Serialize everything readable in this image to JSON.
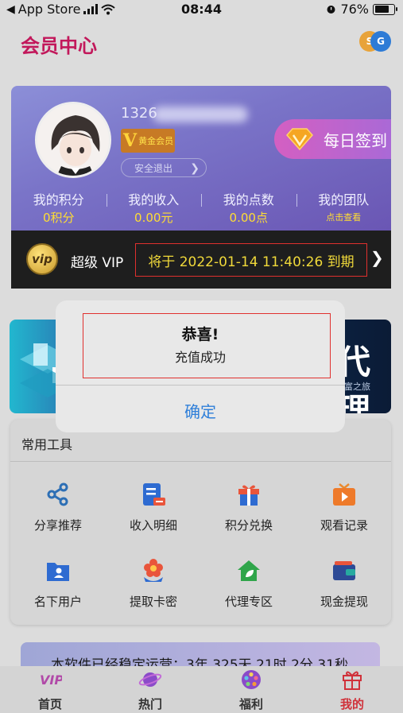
{
  "status_bar": {
    "carrier": "App Store",
    "time": "08:44",
    "battery": "76%",
    "battery_level": 0.76
  },
  "header": {
    "title": "会员中心",
    "logo_letters": [
      "S",
      "G"
    ]
  },
  "profile": {
    "phone_partial": "1326",
    "level_badge": "黄金会员",
    "logout_label": "安全退出",
    "checkin_label": "每日签到",
    "stats": [
      {
        "label": "我的积分",
        "value": "0积分"
      },
      {
        "label": "我的收入",
        "value": "0.00元"
      },
      {
        "label": "我的点数",
        "value": "0.00点"
      },
      {
        "label": "我的团队",
        "value": "点击查看"
      }
    ]
  },
  "vip": {
    "icon_text": "vip",
    "label": "超级 VIP",
    "expire_text": "将于 2022-01-14 11:40:26 到期"
  },
  "banner": {
    "big_text": "代理",
    "sub_text": "财富之旅"
  },
  "tools": {
    "title": "常用工具",
    "items": [
      {
        "label": "分享推荐",
        "icon": "share-icon"
      },
      {
        "label": "收入明细",
        "icon": "income-detail-icon"
      },
      {
        "label": "积分兑换",
        "icon": "gift-box-icon"
      },
      {
        "label": "观看记录",
        "icon": "tv-play-icon"
      },
      {
        "label": "名下用户",
        "icon": "user-folder-icon"
      },
      {
        "label": "提取卡密",
        "icon": "flower-icon"
      },
      {
        "label": "代理专区",
        "icon": "home-leaf-icon"
      },
      {
        "label": "现金提现",
        "icon": "wallet-icon"
      }
    ]
  },
  "notice": {
    "text": "本软件已经稳定运营：3年 325天 21时 2分 31秒"
  },
  "tabbar": {
    "items": [
      {
        "label": "首页",
        "icon": "vip-icon"
      },
      {
        "label": "热门",
        "icon": "planet-icon"
      },
      {
        "label": "福利",
        "icon": "film-reel-icon"
      },
      {
        "label": "我的",
        "icon": "gift-icon"
      }
    ],
    "active_index": 3
  },
  "dialog": {
    "title": "恭喜!",
    "message": "充值成功",
    "confirm_label": "确定"
  },
  "colors": {
    "accent": "#c2185b",
    "link_blue": "#2f7fd9",
    "gold": "#ffdd33",
    "highlight_red": "#e0302e"
  }
}
